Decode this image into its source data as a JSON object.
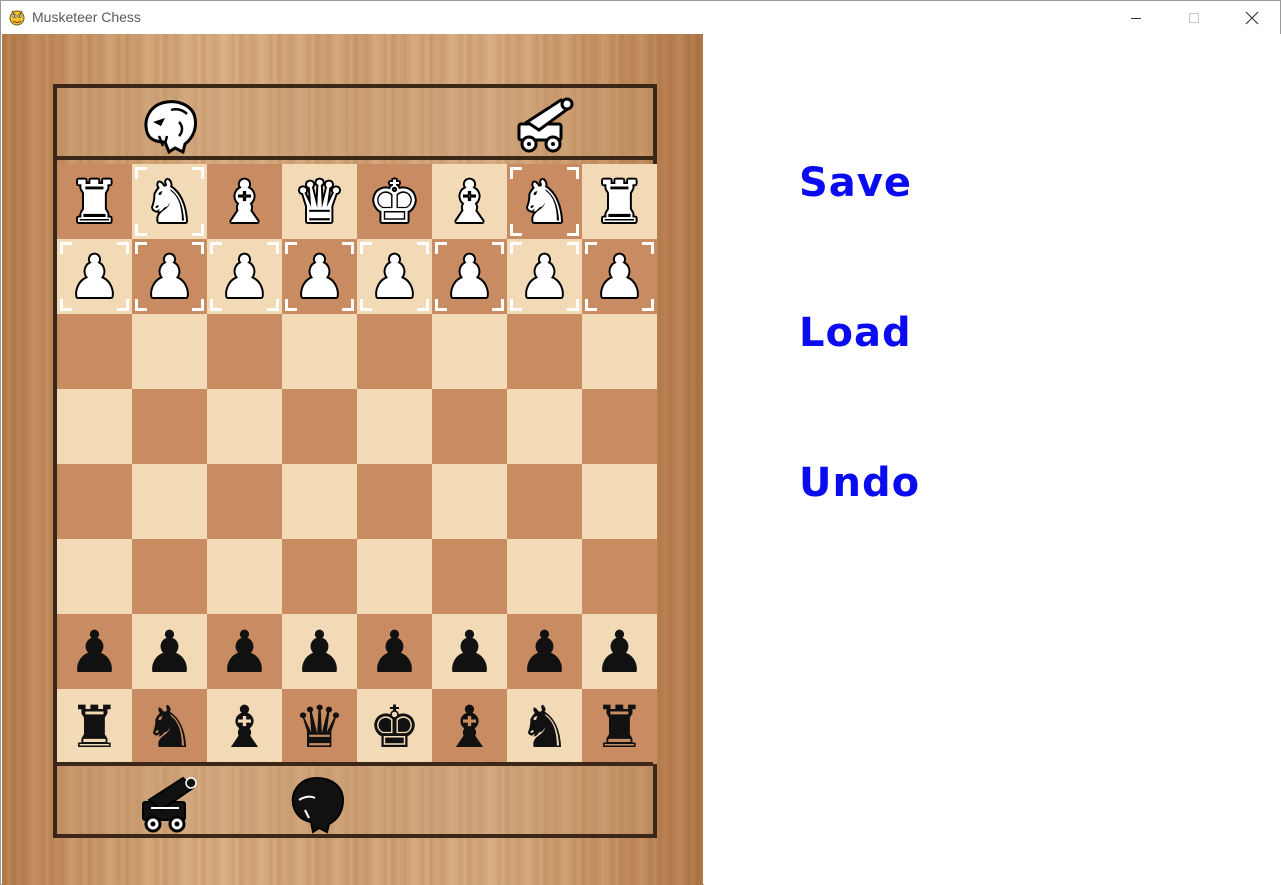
{
  "window": {
    "title": "Musketeer Chess",
    "icon": "pygame-snake-icon"
  },
  "panel": {
    "save_label": "Save",
    "load_label": "Load",
    "undo_label": "Undo",
    "button_color": "#0b0bf2"
  },
  "board": {
    "light_color": "#f2dab6",
    "dark_color": "#c98b62",
    "frame_color": "#3a2718",
    "rows": [
      [
        "w-rook",
        "w-knight",
        "w-bishop",
        "w-queen",
        "w-king",
        "w-bishop",
        "w-knight",
        "w-rook"
      ],
      [
        "w-pawn",
        "w-pawn",
        "w-pawn",
        "w-pawn",
        "w-pawn",
        "w-pawn",
        "w-pawn",
        "w-pawn"
      ],
      [
        "",
        "",
        "",
        "",
        "",
        "",
        "",
        ""
      ],
      [
        "",
        "",
        "",
        "",
        "",
        "",
        "",
        ""
      ],
      [
        "",
        "",
        "",
        "",
        "",
        "",
        "",
        ""
      ],
      [
        "",
        "",
        "",
        "",
        "",
        "",
        "",
        ""
      ],
      [
        "b-pawn",
        "b-pawn",
        "b-pawn",
        "b-pawn",
        "b-pawn",
        "b-pawn",
        "b-pawn",
        "b-pawn"
      ],
      [
        "b-rook",
        "b-knight",
        "b-bishop",
        "b-queen",
        "b-king",
        "b-bishop",
        "b-knight",
        "b-rook"
      ]
    ],
    "selectable_squares": [
      [
        0,
        1
      ],
      [
        0,
        6
      ],
      [
        1,
        0
      ],
      [
        1,
        1
      ],
      [
        1,
        2
      ],
      [
        1,
        3
      ],
      [
        1,
        4
      ],
      [
        1,
        5
      ],
      [
        1,
        6
      ],
      [
        1,
        7
      ]
    ]
  },
  "reserves": {
    "top": [
      {
        "piece": "white-leopard",
        "color": "white"
      },
      {
        "piece": "white-cannon",
        "color": "white"
      }
    ],
    "bottom": [
      {
        "piece": "black-cannon",
        "color": "black"
      },
      {
        "piece": "black-leopard",
        "color": "black"
      }
    ]
  }
}
